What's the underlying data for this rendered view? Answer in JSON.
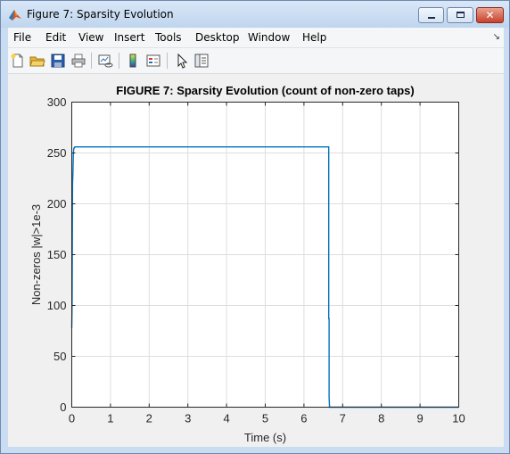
{
  "window": {
    "title": "Figure 7: Sparsity Evolution",
    "close_glyph": "✕"
  },
  "menubar": {
    "items": [
      "File",
      "Edit",
      "View",
      "Insert",
      "Tools",
      "Desktop",
      "Window",
      "Help"
    ],
    "overflow_icon": "dock-arrow-icon"
  },
  "toolbar": {
    "icons": [
      "new-figure-icon",
      "open-file-icon",
      "save-icon",
      "print-icon",
      "link-plot-icon",
      "insert-colorbar-icon",
      "insert-legend-icon",
      "edit-plot-pointer-icon",
      "property-editor-icon"
    ]
  },
  "chart_data": {
    "type": "line",
    "title": "FIGURE 7: Sparsity Evolution (count of non-zero taps)",
    "xlabel": "Time (s)",
    "ylabel": "Non-zeros |w|>1e-3",
    "xlim": [
      0,
      10
    ],
    "ylim": [
      0,
      300
    ],
    "xticks": [
      0,
      1,
      2,
      3,
      4,
      5,
      6,
      7,
      8,
      9,
      10
    ],
    "yticks": [
      0,
      50,
      100,
      150,
      200,
      250,
      300
    ],
    "grid": true,
    "line_color": "#0072bd",
    "series": [
      {
        "x": [
          0,
          0.01,
          0.02,
          0.03,
          0.04,
          0.05,
          0.06,
          0.07,
          0.08,
          0.1,
          6.64,
          6.64,
          6.65,
          6.65,
          6.66,
          6.66,
          10
        ],
        "y": [
          78,
          105,
          220,
          230,
          248,
          254,
          255,
          255,
          256,
          256,
          256,
          87,
          87,
          10,
          1,
          0,
          0
        ]
      }
    ]
  }
}
